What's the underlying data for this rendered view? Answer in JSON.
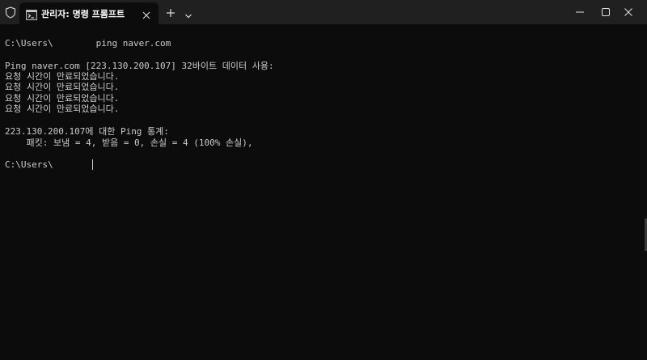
{
  "window": {
    "tab_title": "관리자: 명령 프롬프트",
    "icons": {
      "shield": "shield-icon",
      "tab": "terminal-icon",
      "close_tab": "close-icon",
      "new_tab": "plus-icon",
      "dropdown": "chevron-down-icon",
      "minimize": "minimize-icon",
      "maximize": "maximize-icon",
      "close": "close-icon"
    }
  },
  "terminal": {
    "lines": [
      "C:\\Users\\        ping naver.com",
      "",
      "Ping naver.com [223.130.200.107] 32바이트 데이터 사용:",
      "요청 시간이 만료되었습니다.",
      "요청 시간이 만료되었습니다.",
      "요청 시간이 만료되었습니다.",
      "요청 시간이 만료되었습니다.",
      "",
      "223.130.200.107에 대한 Ping 통계:",
      "    패킷: 보냄 = 4, 받음 = 0, 손실 = 4 (100% 손실),",
      "",
      "C:\\Users\\"
    ]
  },
  "colors": {
    "background": "#0c0c0c",
    "titlebar": "#202020",
    "text": "#cccccc"
  }
}
